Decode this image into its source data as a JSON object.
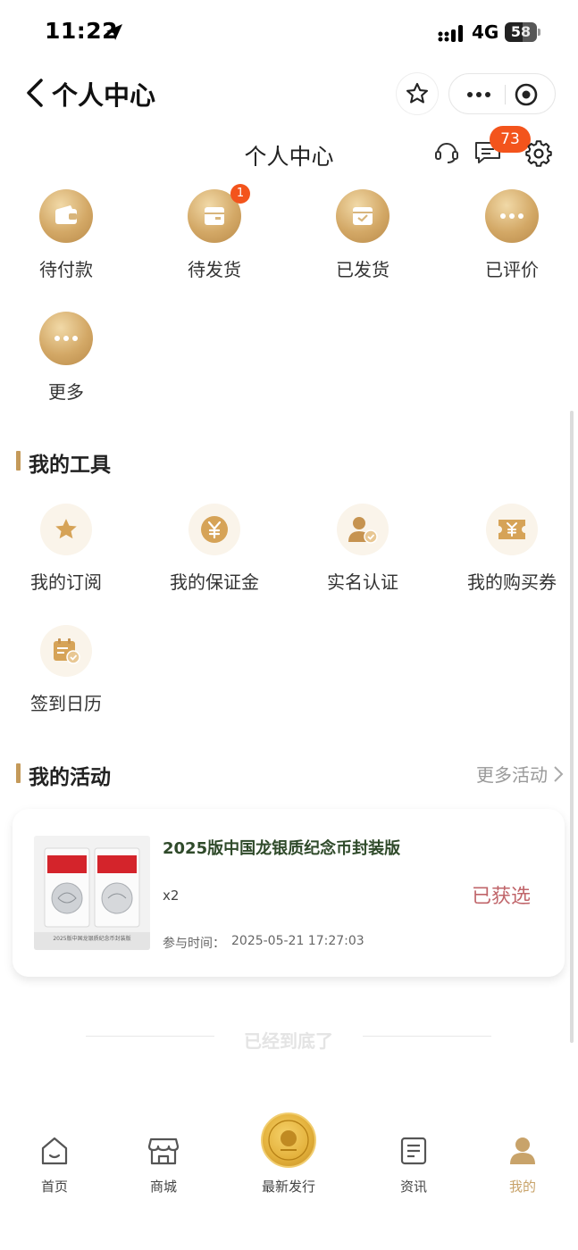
{
  "status_bar": {
    "time": "11:22",
    "network": "4G",
    "battery": "58"
  },
  "nav": {
    "title": "个人中心"
  },
  "header": {
    "title": "个人中心",
    "message_count": "73"
  },
  "orders": [
    {
      "label": "待付款",
      "icon": "wallet-icon",
      "badge": ""
    },
    {
      "label": "待发货",
      "icon": "box-icon",
      "badge": "1"
    },
    {
      "label": "已发货",
      "icon": "shipped-box-icon",
      "badge": ""
    },
    {
      "label": "已评价",
      "icon": "more-dots-icon",
      "badge": ""
    },
    {
      "label": "更多",
      "icon": "more-dots-icon",
      "badge": ""
    }
  ],
  "tools": {
    "title": "我的工具",
    "items": [
      {
        "label": "我的订阅",
        "icon": "star-icon"
      },
      {
        "label": "我的保证金",
        "icon": "yuan-coin-icon"
      },
      {
        "label": "实名认证",
        "icon": "user-verified-icon"
      },
      {
        "label": "我的购买券",
        "icon": "coupon-icon"
      },
      {
        "label": "签到日历",
        "icon": "calendar-check-icon"
      }
    ]
  },
  "activities": {
    "title": "我的活动",
    "more_label": "更多活动",
    "items": [
      {
        "title": "2025版中国龙银质纪念币封装版",
        "image_caption": "2025版中国龙银质纪念币封装版",
        "quantity": "x2",
        "time_label": "参与时间：",
        "time": "2025-05-21 17:27:03",
        "status": "已获选"
      }
    ]
  },
  "end_text": "已经到底了",
  "tabs": [
    {
      "label": "首页",
      "icon": "home-icon",
      "active": false
    },
    {
      "label": "商城",
      "icon": "store-icon",
      "active": false
    },
    {
      "label": "最新发行",
      "icon": "coin-icon",
      "active": false
    },
    {
      "label": "资讯",
      "icon": "news-icon",
      "active": false
    },
    {
      "label": "我的",
      "icon": "profile-icon",
      "active": true
    }
  ],
  "colors": {
    "accent_gold": "#c8a36a",
    "badge_orange": "#f3541c",
    "status_red": "#c0656a"
  }
}
